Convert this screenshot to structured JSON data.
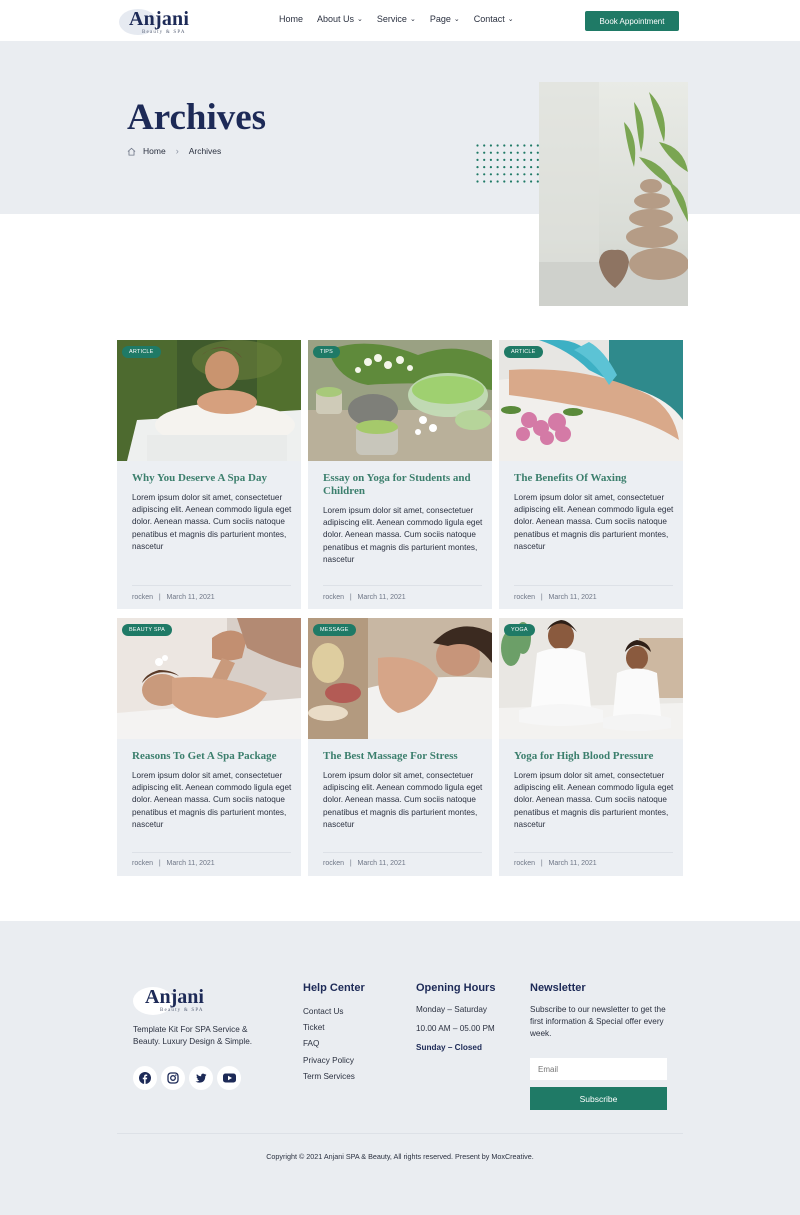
{
  "header": {
    "logo_name": "Anjani",
    "logo_sub": "Beauty & SPA",
    "nav": [
      {
        "label": "Home",
        "has_dropdown": false
      },
      {
        "label": "About Us",
        "has_dropdown": true
      },
      {
        "label": "Service",
        "has_dropdown": true
      },
      {
        "label": "Page",
        "has_dropdown": true
      },
      {
        "label": "Contact",
        "has_dropdown": true
      }
    ],
    "cta": "Book Appointment"
  },
  "hero": {
    "title": "Archives",
    "breadcrumb": [
      "Home",
      "Archives"
    ]
  },
  "posts": [
    {
      "tag": "ARTICLE",
      "title": "Why You Deserve A Spa Day",
      "excerpt": "Lorem ipsum dolor sit amet, consectetuer adipiscing elit. Aenean commodo ligula eget dolor. Aenean massa. Cum sociis natoque penatibus et magnis dis parturient montes, nascetur",
      "author": "rocken",
      "date": "March 11, 2021"
    },
    {
      "tag": "TIPS",
      "title": "Essay on Yoga for Students and Children",
      "excerpt": "Lorem ipsum dolor sit amet, consectetuer adipiscing elit. Aenean commodo ligula eget dolor. Aenean massa. Cum sociis natoque penatibus et magnis dis parturient montes, nascetur",
      "author": "rocken",
      "date": "March 11, 2021"
    },
    {
      "tag": "ARTICLE",
      "title": "The Benefits Of Waxing",
      "excerpt": "Lorem ipsum dolor sit amet, consectetuer adipiscing elit. Aenean commodo ligula eget dolor. Aenean massa. Cum sociis natoque penatibus et magnis dis parturient montes, nascetur",
      "author": "rocken",
      "date": "March 11, 2021"
    },
    {
      "tag": "BEAUTY SPA",
      "title": "Reasons To Get A Spa Package",
      "excerpt": "Lorem ipsum dolor sit amet, consectetuer adipiscing elit. Aenean commodo ligula eget dolor. Aenean massa. Cum sociis natoque penatibus et magnis dis parturient montes, nascetur",
      "author": "rocken",
      "date": "March 11, 2021"
    },
    {
      "tag": "MESSAGE",
      "title": "The Best Massage For Stress",
      "excerpt": "Lorem ipsum dolor sit amet, consectetuer adipiscing elit. Aenean commodo ligula eget dolor. Aenean massa. Cum sociis natoque penatibus et magnis dis parturient montes, nascetur",
      "author": "rocken",
      "date": "March 11, 2021"
    },
    {
      "tag": "YOGA",
      "title": "Yoga for High Blood Pressure",
      "excerpt": "Lorem ipsum dolor sit amet, consectetuer adipiscing elit. Aenean commodo ligula eget dolor. Aenean massa. Cum sociis natoque penatibus et magnis dis parturient montes, nascetur",
      "author": "rocken",
      "date": "March 11, 2021"
    }
  ],
  "footer": {
    "logo_name": "Anjani",
    "logo_sub": "Beauty & SPA",
    "tagline": "Template Kit For SPA Service & Beauty. Luxury Design & Simple.",
    "socials": [
      "facebook-icon",
      "instagram-icon",
      "twitter-icon",
      "youtube-icon"
    ],
    "help_title": "Help Center",
    "help_links": [
      "Contact Us",
      "Ticket",
      "FAQ",
      "Privacy Policy",
      "Term Services"
    ],
    "hours_title": "Opening Hours",
    "hours": [
      "Monday – Saturday",
      "10.00 AM – 05.00 PM",
      "Sunday – Closed"
    ],
    "news_title": "Newsletter",
    "news_desc": "Subscribe to our newsletter to get the first information & Special offer every week.",
    "email_placeholder": "Email",
    "subscribe": "Subscribe",
    "copyright": "Copyright © 2021 Anjani SPA & Beauty, All rights reserved. Present by MoxCreative."
  },
  "colors": {
    "accent": "#1f7a66",
    "navy": "#1d2a57",
    "title_green": "#3c7f6d",
    "surface": "#eaedf1"
  }
}
